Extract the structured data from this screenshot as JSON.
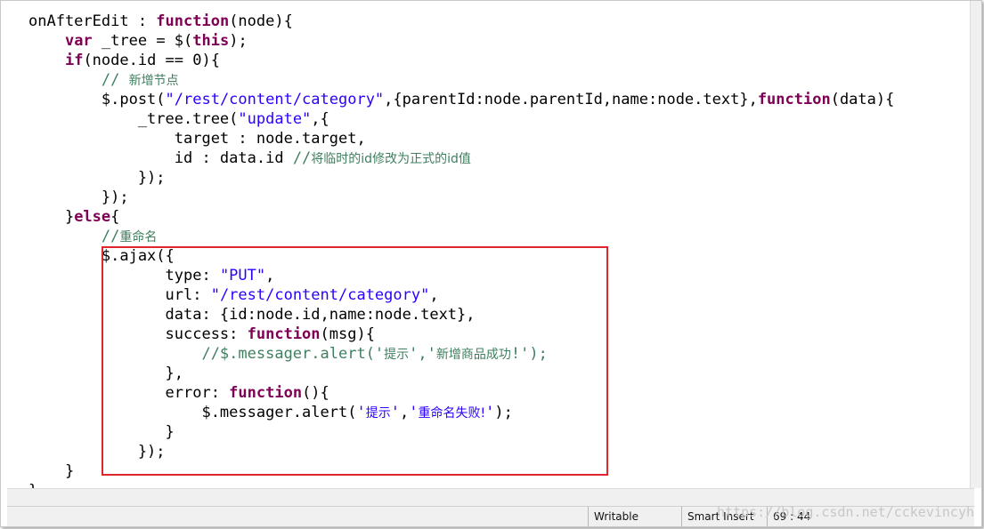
{
  "editor": {
    "lines": [
      [
        {
          "t": "onAfterEdit : "
        },
        {
          "t": "function",
          "c": "kw"
        },
        {
          "t": "(node){"
        }
      ],
      [
        {
          "t": "    "
        },
        {
          "t": "var",
          "c": "kw"
        },
        {
          "t": " _tree = $("
        },
        {
          "t": "this",
          "c": "kw"
        },
        {
          "t": ");"
        }
      ],
      [
        {
          "t": "    "
        },
        {
          "t": "if",
          "c": "kw"
        },
        {
          "t": "(node.id == 0){"
        }
      ],
      [
        {
          "t": "        // ",
          "c": "cm"
        },
        {
          "t": "新增节点",
          "c": "cm cn"
        }
      ],
      [
        {
          "t": "        $.post("
        },
        {
          "t": "\"/rest/content/category\"",
          "c": "str"
        },
        {
          "t": ",{parentId:node.parentId,name:node.text},"
        },
        {
          "t": "function",
          "c": "kw"
        },
        {
          "t": "(data){"
        }
      ],
      [
        {
          "t": "            _tree.tree("
        },
        {
          "t": "\"update\"",
          "c": "str"
        },
        {
          "t": ",{"
        }
      ],
      [
        {
          "t": "                target : node.target,"
        }
      ],
      [
        {
          "t": "                id : data.id "
        },
        {
          "t": "//",
          "c": "cm"
        },
        {
          "t": "将临时的id修改为正式的id值",
          "c": "cm cn"
        }
      ],
      [
        {
          "t": "            });"
        }
      ],
      [
        {
          "t": "        });"
        }
      ],
      [
        {
          "t": "    }"
        },
        {
          "t": "else",
          "c": "kw"
        },
        {
          "t": "{"
        }
      ],
      [
        {
          "t": "        //",
          "c": "cm"
        },
        {
          "t": "重命名",
          "c": "cm cn"
        }
      ],
      [
        {
          "t": "        $.ajax({"
        }
      ],
      [
        {
          "t": "               type: "
        },
        {
          "t": "\"PUT\"",
          "c": "str"
        },
        {
          "t": ","
        }
      ],
      [
        {
          "t": "               url: "
        },
        {
          "t": "\"/rest/content/category\"",
          "c": "str"
        },
        {
          "t": ","
        }
      ],
      [
        {
          "t": "               data: {id:node.id,name:node.text},"
        }
      ],
      [
        {
          "t": "               success: "
        },
        {
          "t": "function",
          "c": "kw"
        },
        {
          "t": "(msg){"
        }
      ],
      [
        {
          "t": "                   //$.messager.alert('",
          "c": "cm"
        },
        {
          "t": "提示",
          "c": "cm cn"
        },
        {
          "t": "','",
          "c": "cm"
        },
        {
          "t": "新增商品成功",
          "c": "cm cn"
        },
        {
          "t": "!');",
          "c": "cm"
        }
      ],
      [
        {
          "t": "               },"
        }
      ],
      [
        {
          "t": "               error: "
        },
        {
          "t": "function",
          "c": "kw"
        },
        {
          "t": "(){"
        }
      ],
      [
        {
          "t": "                   $.messager.alert("
        },
        {
          "t": "'",
          "c": "str"
        },
        {
          "t": "提示",
          "c": "str cn"
        },
        {
          "t": "'",
          "c": "str"
        },
        {
          "t": ","
        },
        {
          "t": "'",
          "c": "str"
        },
        {
          "t": "重命名失败!",
          "c": "str cn"
        },
        {
          "t": "'",
          "c": "str"
        },
        {
          "t": ");"
        }
      ],
      [
        {
          "t": "               }"
        }
      ],
      [
        {
          "t": "            });"
        }
      ],
      [
        {
          "t": "    }"
        }
      ],
      [
        {
          "t": "}"
        }
      ]
    ],
    "first_line_partial": "},"
  },
  "status": {
    "writable": "Writable",
    "insert_mode": "Smart Insert",
    "position": "69 : 44"
  },
  "watermark": "https://blog.csdn.net/cckevincyh",
  "colors": {
    "keyword": "#7f0055",
    "string": "#2a00ff",
    "comment": "#3f7f5f",
    "highlight_box": "#e0262d"
  }
}
